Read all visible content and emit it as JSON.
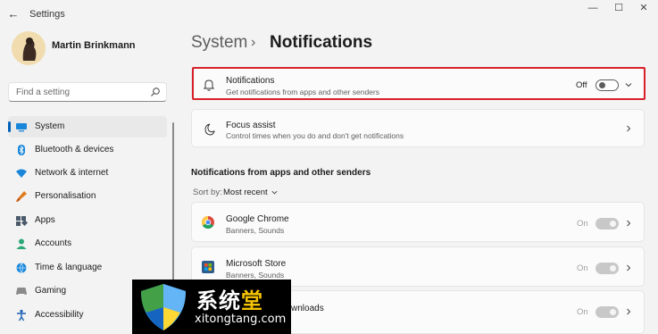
{
  "window": {
    "back_glyph": "←",
    "title": "Settings",
    "minimize_glyph": "—",
    "maximize_glyph": "☐",
    "close_glyph": "✕"
  },
  "user": {
    "name": "Martin Brinkmann"
  },
  "search": {
    "placeholder": "Find a setting",
    "icon": "search-icon"
  },
  "sidebar": {
    "items": [
      {
        "label": "System",
        "icon": "monitor-icon",
        "active": true
      },
      {
        "label": "Bluetooth & devices",
        "icon": "bluetooth-icon"
      },
      {
        "label": "Network & internet",
        "icon": "wifi-icon"
      },
      {
        "label": "Personalisation",
        "icon": "brush-icon"
      },
      {
        "label": "Apps",
        "icon": "apps-icon"
      },
      {
        "label": "Accounts",
        "icon": "person-icon"
      },
      {
        "label": "Time & language",
        "icon": "globe-icon"
      },
      {
        "label": "Gaming",
        "icon": "gamepad-icon"
      },
      {
        "label": "Accessibility",
        "icon": "accessibility-icon"
      }
    ]
  },
  "breadcrumb": {
    "parent": "System",
    "separator": "›",
    "current": "Notifications"
  },
  "notifications": {
    "title": "Notifications",
    "subtitle": "Get notifications from apps and other senders",
    "state": "Off"
  },
  "focus_assist": {
    "title": "Focus assist",
    "subtitle": "Control times when you do and don't get notifications"
  },
  "apps_section": {
    "heading": "Notifications from apps and other senders",
    "sort_label": "Sort by:",
    "sort_value": "Most recent",
    "apps": [
      {
        "name": "Google Chrome",
        "detail": "Banners, Sounds",
        "state": "On",
        "icon": "chrome-icon"
      },
      {
        "name": "Microsoft Store",
        "detail": "Banners, Sounds",
        "state": "On",
        "icon": "store-icon"
      },
      {
        "name": "wnloads",
        "state": "On"
      }
    ]
  },
  "watermark": {
    "cn_text": "系统",
    "cn_text_accent": "堂",
    "url": "xitongtang.com"
  },
  "colors": {
    "accent": "#005fb8",
    "highlight_border": "#d8202a"
  }
}
